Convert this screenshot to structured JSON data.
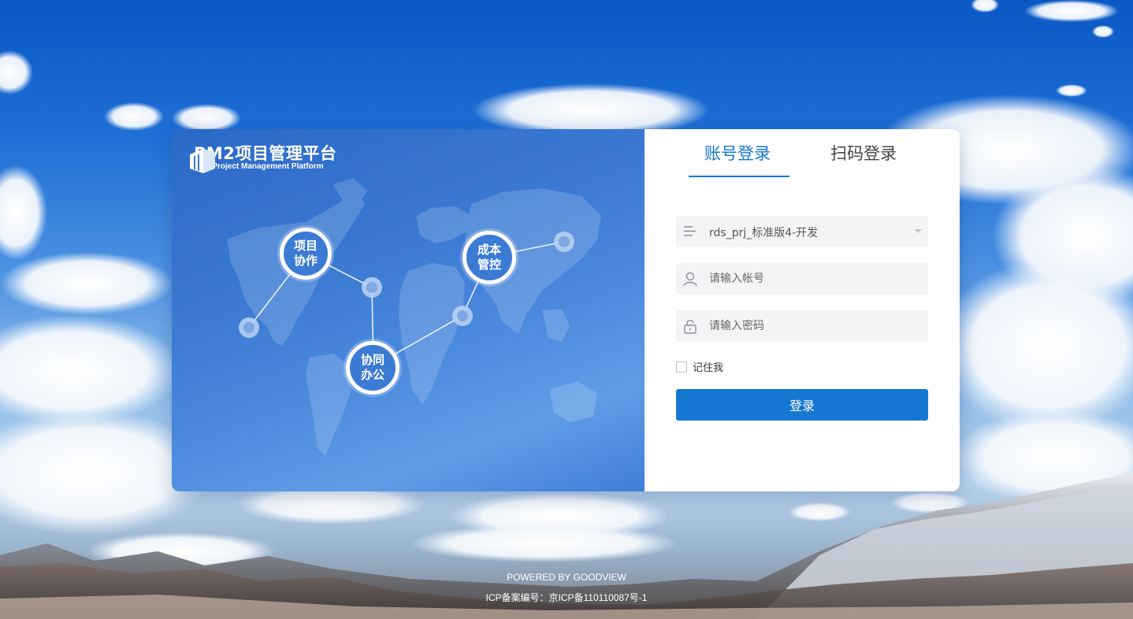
{
  "brand": {
    "title": "PM2项目管理平台",
    "subtitle": "PM2 Project Management Platform"
  },
  "features": [
    {
      "label": "项目\n协作",
      "line1": "项目",
      "line2": "协作"
    },
    {
      "label": "成本\n管控",
      "line1": "成本",
      "line2": "管控"
    },
    {
      "label": "协同\n办公",
      "line1": "协同",
      "line2": "办公"
    }
  ],
  "tabs": {
    "account": "账号登录",
    "qr": "扫码登录",
    "active": "account"
  },
  "form": {
    "workspace": {
      "icon": "list-icon",
      "selected": "rds_prj_标准版4-开发"
    },
    "username": {
      "icon": "user-icon",
      "placeholder": "请输入帐号",
      "value": ""
    },
    "password": {
      "icon": "lock-icon",
      "placeholder": "请输入密码",
      "value": ""
    },
    "remember_label": "记住我",
    "remember_checked": false,
    "submit_label": "登录"
  },
  "footer": {
    "powered_by": "POWERED BY GOODVIEW",
    "icp": "ICP备案编号：京ICP备110110087号-1"
  },
  "colors": {
    "accent": "#1677d2",
    "promo_panel": "#3a79d2",
    "field_bg": "#f3f4f6"
  }
}
